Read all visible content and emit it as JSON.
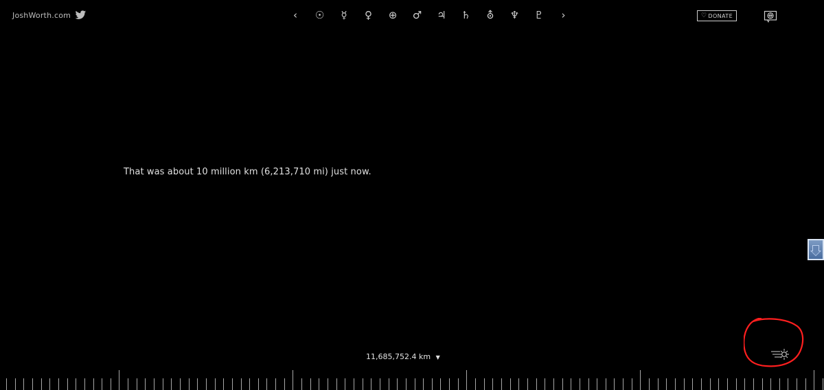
{
  "header": {
    "site_name": "JoshWorth.com",
    "twitter_icon": "twitter-icon",
    "navigation": [
      {
        "name": "previous",
        "symbol": "‹"
      },
      {
        "name": "sun",
        "symbol": "☉"
      },
      {
        "name": "mercury",
        "symbol": "☿"
      },
      {
        "name": "venus",
        "symbol": "♀"
      },
      {
        "name": "earth",
        "symbol": "⊕"
      },
      {
        "name": "mars",
        "symbol": "♂"
      },
      {
        "name": "jupiter",
        "symbol": "♃"
      },
      {
        "name": "saturn",
        "symbol": "♄"
      },
      {
        "name": "uranus",
        "symbol": "⛢"
      },
      {
        "name": "neptune",
        "symbol": "♆"
      },
      {
        "name": "pluto",
        "symbol": "♇"
      },
      {
        "name": "next",
        "symbol": "›"
      }
    ],
    "donate": {
      "icon": "heart-icon",
      "label": "DONATE"
    },
    "language_icon": "globe-icon"
  },
  "content": {
    "message": "That was about 10 million km (6,213,710 mi) just now.",
    "distance": "11,685,752.4 km",
    "distance_indicator": "caret-down-icon",
    "scroll_button": "scroll-down-icon",
    "light_speed_icon": "light-speed-sun-icon"
  },
  "colors": {
    "background": "#000000",
    "text": "#e0e0e0",
    "annotation": "#ff1f1f",
    "scroll_button": "#5f80b0"
  }
}
